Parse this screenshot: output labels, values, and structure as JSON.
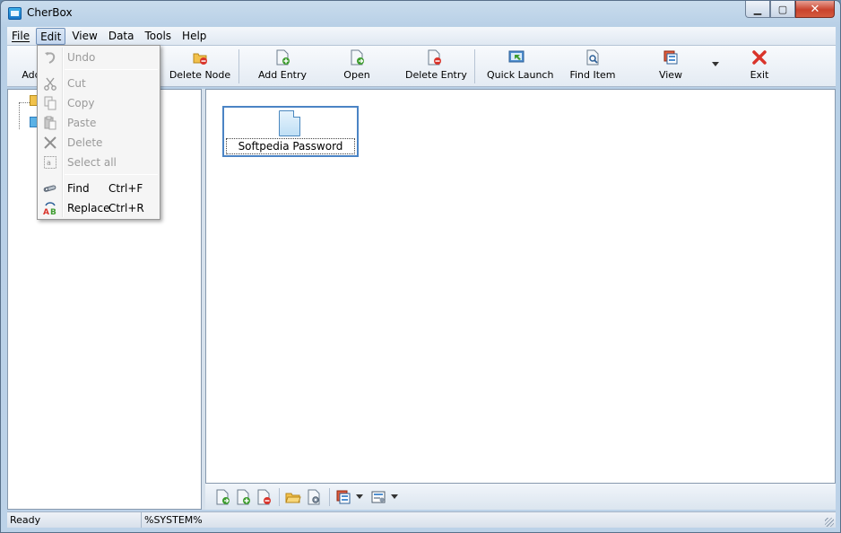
{
  "window": {
    "title": "CherBox"
  },
  "menubar": {
    "items": [
      {
        "label": "File",
        "hotkey": "F"
      },
      {
        "label": "Edit",
        "hotkey": "E"
      },
      {
        "label": "View",
        "hotkey": "V"
      },
      {
        "label": "Data",
        "hotkey": "D"
      },
      {
        "label": "Tools",
        "hotkey": "T"
      },
      {
        "label": "Help",
        "hotkey": "H"
      }
    ]
  },
  "toolbar": {
    "buttons": [
      {
        "label": "Add",
        "icon": "add-node-icon"
      },
      {
        "label": "Delete Node",
        "icon": "delete-node-icon"
      },
      {
        "label": "Add Entry",
        "icon": "add-entry-icon"
      },
      {
        "label": "Open",
        "icon": "open-icon"
      },
      {
        "label": "Delete Entry",
        "icon": "delete-entry-icon"
      },
      {
        "label": "Quick Launch",
        "icon": "quick-launch-icon"
      },
      {
        "label": "Find Item",
        "icon": "find-item-icon"
      },
      {
        "label": "View",
        "icon": "view-icon"
      },
      {
        "label": "Exit",
        "icon": "exit-icon"
      }
    ]
  },
  "edit_menu": {
    "items": [
      {
        "label": "Undo",
        "shortcut": "",
        "enabled": false,
        "icon": "undo-icon"
      },
      {
        "label": "Cut",
        "shortcut": "",
        "enabled": false,
        "icon": "cut-icon"
      },
      {
        "label": "Copy",
        "shortcut": "",
        "enabled": false,
        "icon": "copy-icon"
      },
      {
        "label": "Paste",
        "shortcut": "",
        "enabled": false,
        "icon": "paste-icon"
      },
      {
        "label": "Delete",
        "shortcut": "",
        "enabled": false,
        "icon": "delete-icon"
      },
      {
        "label": "Select all",
        "shortcut": "",
        "enabled": false,
        "icon": "select-all-icon"
      },
      {
        "label": "Find",
        "shortcut": "Ctrl+F",
        "enabled": true,
        "icon": "find-icon"
      },
      {
        "label": "Replace",
        "shortcut": "Ctrl+R",
        "enabled": true,
        "icon": "replace-icon"
      }
    ]
  },
  "content": {
    "entries": [
      {
        "label": "Softpedia Password",
        "icon": "document-icon"
      }
    ]
  },
  "statusbar": {
    "status": "Ready",
    "path": "%SYSTEM%"
  }
}
